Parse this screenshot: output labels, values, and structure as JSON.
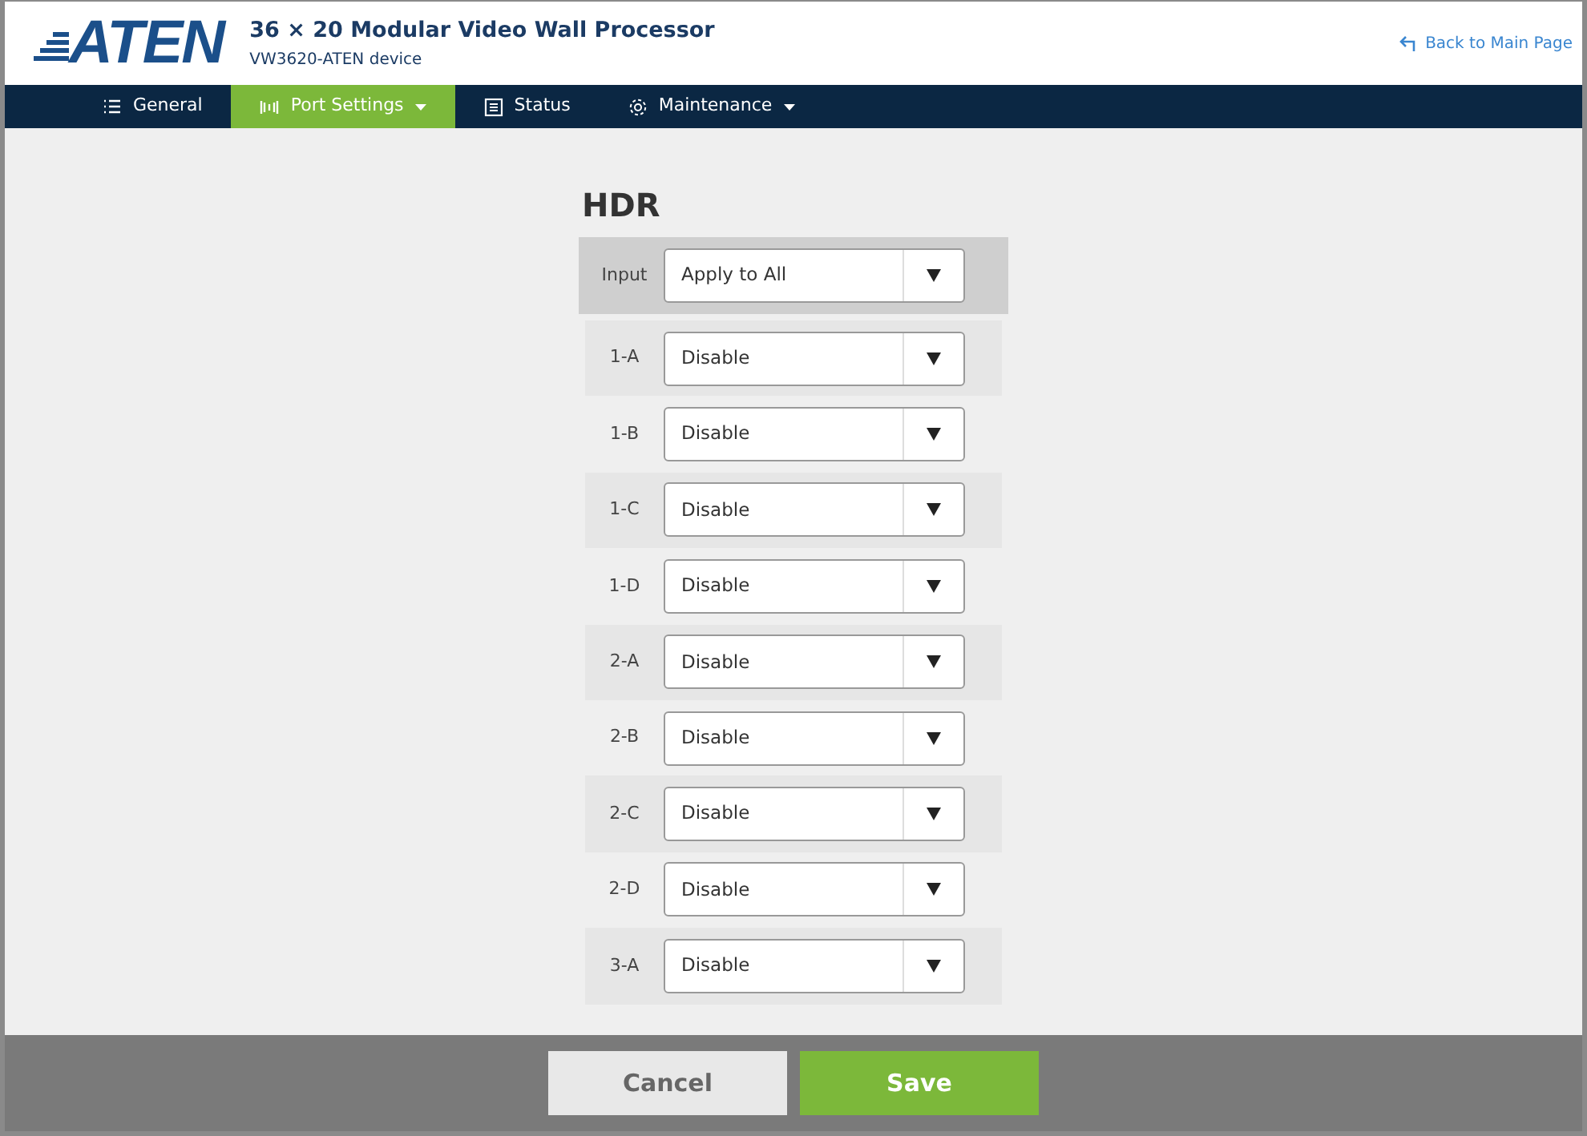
{
  "header": {
    "logo": "ATEN",
    "title": "36 × 20 Modular Video Wall Processor",
    "subtitle": "VW3620-ATEN device",
    "back_link": "Back to Main Page"
  },
  "nav": [
    {
      "label": "General",
      "kind": "list",
      "selected": false,
      "dropdown": false
    },
    {
      "label": "Port Settings",
      "kind": "port",
      "selected": true,
      "dropdown": true
    },
    {
      "label": "Status",
      "kind": "status",
      "selected": false,
      "dropdown": false
    },
    {
      "label": "Maintenance",
      "kind": "gear",
      "selected": false,
      "dropdown": true
    }
  ],
  "panel": {
    "title": "HDR",
    "input": {
      "label": "Input",
      "value": "Apply to All"
    },
    "rows": [
      {
        "label": "1-A",
        "value": "Disable"
      },
      {
        "label": "1-B",
        "value": "Disable"
      },
      {
        "label": "1-C",
        "value": "Disable"
      },
      {
        "label": "1-D",
        "value": "Disable"
      },
      {
        "label": "2-A",
        "value": "Disable"
      },
      {
        "label": "2-B",
        "value": "Disable"
      },
      {
        "label": "2-C",
        "value": "Disable"
      },
      {
        "label": "2-D",
        "value": "Disable"
      },
      {
        "label": "3-A",
        "value": "Disable"
      }
    ]
  },
  "footer": {
    "buttons": [
      {
        "label": "Cancel",
        "kind": "secondary"
      },
      {
        "label": "Save",
        "kind": "primary"
      }
    ]
  }
}
